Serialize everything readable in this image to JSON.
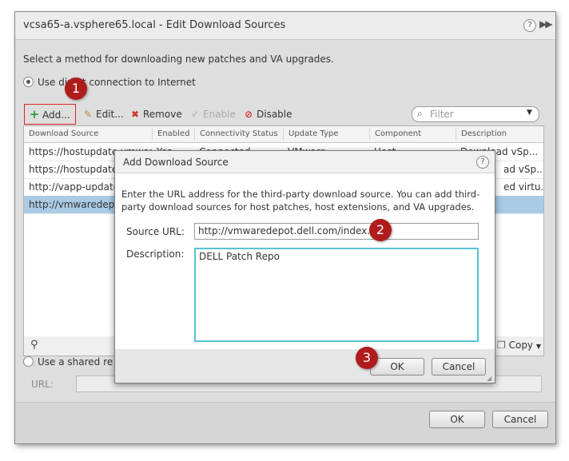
{
  "outer": {
    "title": "vcsa65-a.vsphere65.local - Edit Download Sources",
    "help_glyph": "?",
    "more_glyph": "▶▶",
    "instruction": "Select a method for downloading new patches and VA upgrades.",
    "radio_direct_label": "Use direct connection to Internet",
    "radio_shared_label": "Use a shared repository",
    "url_label": "URL:",
    "toolbar": {
      "add_label": "Add...",
      "edit_label": "Edit...",
      "remove_label": "Remove",
      "enable_label": "Enable",
      "disable_label": "Disable",
      "filter_placeholder": "Filter"
    },
    "table": {
      "columns": [
        "Download Source",
        "Enabled",
        "Connectivity Status",
        "Update Type",
        "Component",
        "Description"
      ],
      "rows": [
        {
          "source": "https://hostupdate.vmware...",
          "enabled": "Yes",
          "status": "Connected",
          "type": "VMware",
          "component": "Host",
          "description": "Download vSp..."
        },
        {
          "source": "https://hostupdate.vm",
          "enabled": "",
          "status": "",
          "type": "",
          "component": "",
          "description": "ad vSp..."
        },
        {
          "source": "http://vapp-updates.",
          "enabled": "",
          "status": "",
          "type": "",
          "component": "",
          "description": "ed virtu..."
        },
        {
          "source": "http://vmwaredepot.",
          "enabled": "",
          "status": "",
          "type": "",
          "component": "",
          "description": ""
        }
      ]
    },
    "copy_label": "Copy",
    "ok_label": "OK",
    "cancel_label": "Cancel"
  },
  "dialog": {
    "title": "Add Download Source",
    "help_glyph": "?",
    "intro": "Enter the URL address for the third-party download source. You can add third-party download sources for host patches, host extensions, and VA upgrades.",
    "source_url_label": "Source URL:",
    "source_url_value": "http://vmwaredepot.dell.com/index.xml",
    "description_label": "Description:",
    "description_value": "DELL Patch Repo",
    "ok_label": "OK",
    "cancel_label": "Cancel"
  },
  "callouts": [
    "1",
    "2",
    "3"
  ],
  "colors": {
    "callout": "#b01c1c",
    "selected_row": "#a9cbe6",
    "focus_border": "#55c3d6",
    "add_icon": "#2e9b2e",
    "remove_icon": "#d0312d"
  }
}
